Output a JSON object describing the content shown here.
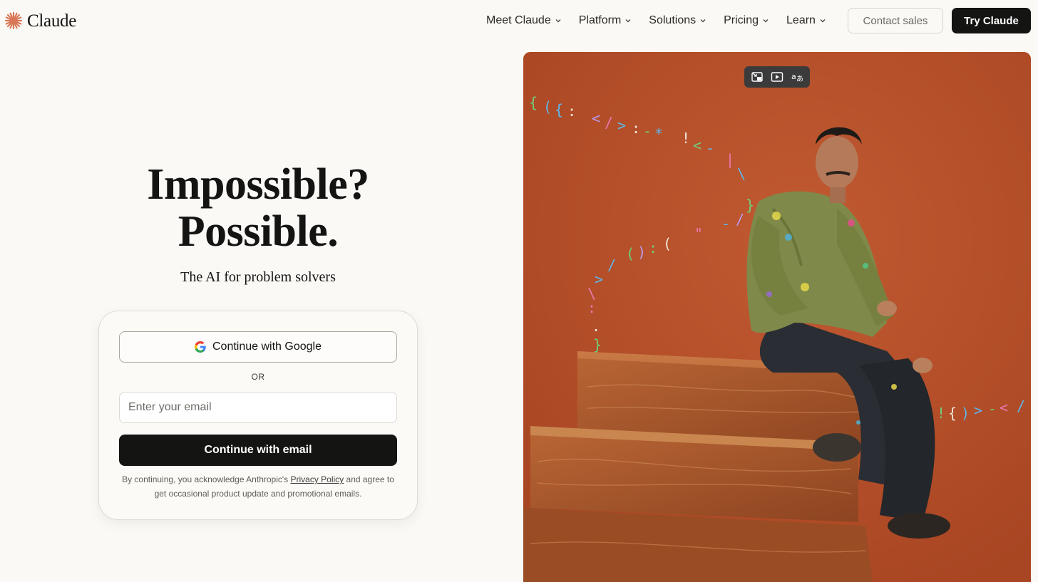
{
  "brand": {
    "name": "Claude",
    "accent": "#d97757"
  },
  "nav": {
    "items": [
      {
        "label": "Meet Claude"
      },
      {
        "label": "Platform"
      },
      {
        "label": "Solutions"
      },
      {
        "label": "Pricing"
      },
      {
        "label": "Learn"
      }
    ],
    "contact_label": "Contact sales",
    "try_label": "Try Claude"
  },
  "hero": {
    "title_line1": "Impossible?",
    "title_line2": "Possible.",
    "subtitle": "The AI for problem solvers"
  },
  "login": {
    "google_label": "Continue with Google",
    "or_label": "OR",
    "email_placeholder": "Enter your email",
    "email_value": "",
    "email_button_label": "Continue with email",
    "legal_before": "By continuing, you acknowledge Anthropic's ",
    "legal_link": "Privacy Policy",
    "legal_after": " and agree to get occasional product update and promotional emails."
  },
  "image_toolbar": {
    "icons": [
      "pip-exit-icon",
      "video-play-icon",
      "translate-icon"
    ]
  },
  "colors": {
    "background": "#faf9f5",
    "primary_button": "#141413",
    "image_background": "#b9522c"
  }
}
